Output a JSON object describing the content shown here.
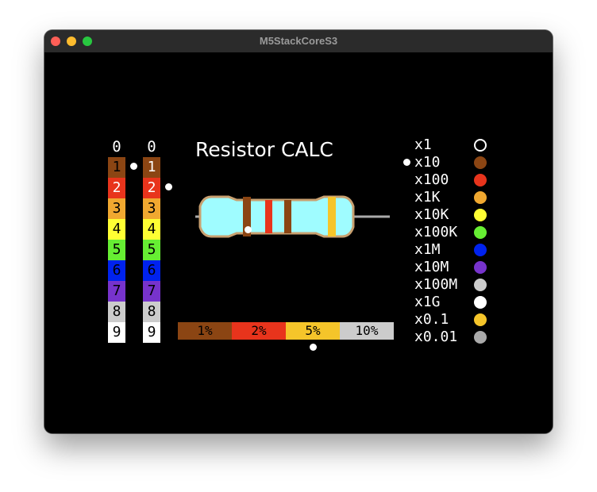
{
  "window": {
    "title": "M5StackCoreS3",
    "traffic_lights": [
      "#ff5f57",
      "#febc2e",
      "#28c840"
    ]
  },
  "app": {
    "title": "Resistor CALC",
    "columns": [
      {
        "header": "0",
        "selected_index": 0,
        "digits": [
          "1",
          "2",
          "3",
          "4",
          "5",
          "6",
          "7",
          "8",
          "9"
        ],
        "colors": [
          "#8b4513",
          "#e8341c",
          "#f0a830",
          "#ffff33",
          "#66ee33",
          "#0022ee",
          "#7733cc",
          "#cccccc",
          "#ffffff"
        ],
        "text_colors": [
          "#000000",
          "#ffffff",
          "#000000",
          "#000000",
          "#000000",
          "#000000",
          "#000000",
          "#000000",
          "#000000"
        ]
      },
      {
        "header": "0",
        "selected_index": 1,
        "digits": [
          "1",
          "2",
          "3",
          "4",
          "5",
          "6",
          "7",
          "8",
          "9"
        ],
        "colors": [
          "#8b4513",
          "#e8341c",
          "#f0a830",
          "#ffff33",
          "#66ee33",
          "#0022ee",
          "#7733cc",
          "#cccccc",
          "#ffffff"
        ],
        "text_colors": [
          "#ffffff",
          "#ffffff",
          "#000000",
          "#000000",
          "#000000",
          "#000000",
          "#000000",
          "#000000",
          "#000000"
        ]
      }
    ],
    "resistor": {
      "body_color": "#9ffcff",
      "outline_color": "#c8a070",
      "lead_color": "#aaaaaa",
      "bands": [
        "#8b4513",
        "#e8341c",
        "#8b4513",
        "#f5c52a"
      ]
    },
    "tolerance": {
      "items": [
        {
          "label": "1%",
          "color": "#8b4513"
        },
        {
          "label": "2%",
          "color": "#e8341c"
        },
        {
          "label": "5%",
          "color": "#f5c52a"
        },
        {
          "label": "10%",
          "color": "#cccccc"
        }
      ],
      "selected_index": 2
    },
    "multipliers": {
      "selected_index": 1,
      "items": [
        {
          "label": "x1",
          "color": "none",
          "outline": true
        },
        {
          "label": "x10",
          "color": "#8b4513"
        },
        {
          "label": "x100",
          "color": "#e8341c"
        },
        {
          "label": "x1K",
          "color": "#f0a830"
        },
        {
          "label": "x10K",
          "color": "#ffff33"
        },
        {
          "label": "x100K",
          "color": "#66ee33"
        },
        {
          "label": "x1M",
          "color": "#0022ee"
        },
        {
          "label": "x10M",
          "color": "#7733cc"
        },
        {
          "label": "x100M",
          "color": "#cccccc"
        },
        {
          "label": "x1G",
          "color": "#ffffff"
        },
        {
          "label": "x0.1",
          "color": "#f5c52a"
        },
        {
          "label": "x0.01",
          "color": "#aaaaaa"
        }
      ]
    }
  }
}
